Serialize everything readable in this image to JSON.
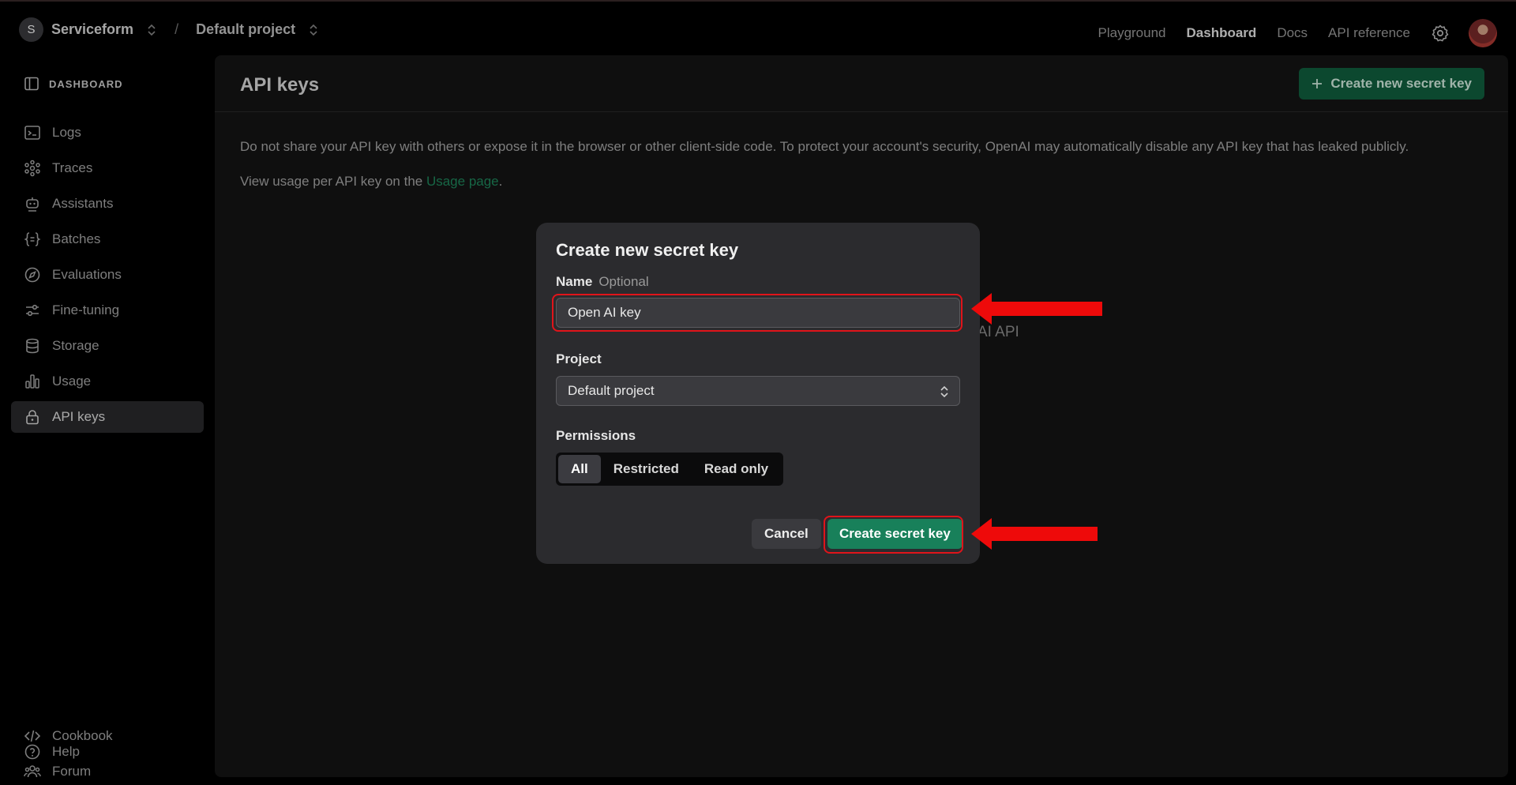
{
  "topbar": {
    "org_initial": "S",
    "org_name": "Serviceform",
    "separator": "/",
    "project_name": "Default project",
    "nav": [
      "Playground",
      "Dashboard",
      "Docs",
      "API reference"
    ],
    "active_nav": "Dashboard"
  },
  "sidebar": {
    "header": "DASHBOARD",
    "items": [
      {
        "label": "Logs",
        "icon": "terminal-icon"
      },
      {
        "label": "Traces",
        "icon": "nodes-icon"
      },
      {
        "label": "Assistants",
        "icon": "robot-icon"
      },
      {
        "label": "Batches",
        "icon": "batches-icon"
      },
      {
        "label": "Evaluations",
        "icon": "compass-icon"
      },
      {
        "label": "Fine-tuning",
        "icon": "sliders-icon"
      },
      {
        "label": "Storage",
        "icon": "database-icon"
      },
      {
        "label": "Usage",
        "icon": "bar-chart-icon"
      },
      {
        "label": "API keys",
        "icon": "lock-icon"
      }
    ],
    "active_item": "API keys",
    "footer": [
      {
        "label": "Cookbook",
        "icon": "code-icon"
      },
      {
        "label": "Forum",
        "icon": "people-icon"
      },
      {
        "label": "Help",
        "icon": "help-icon"
      }
    ]
  },
  "main": {
    "title": "API keys",
    "create_button": "Create new secret key",
    "notice": "Do not share your API key with others or expose it in the browser or other client-side code. To protect your account's security, OpenAI may automatically disable any API key that has leaked publicly.",
    "usage_prefix": "View usage per API key on the ",
    "usage_link": "Usage page",
    "usage_suffix": ".",
    "behind_text": "AI API"
  },
  "modal": {
    "title": "Create new secret key",
    "name_label": "Name",
    "name_optional": "Optional",
    "name_value": "Open AI key",
    "project_label": "Project",
    "project_value": "Default project",
    "permissions_label": "Permissions",
    "permissions": [
      "All",
      "Restricted",
      "Read only"
    ],
    "permissions_selected": "All",
    "cancel": "Cancel",
    "submit": "Create secret key"
  },
  "colors": {
    "accent_green": "#10603f",
    "highlight_red": "#e0141a"
  }
}
